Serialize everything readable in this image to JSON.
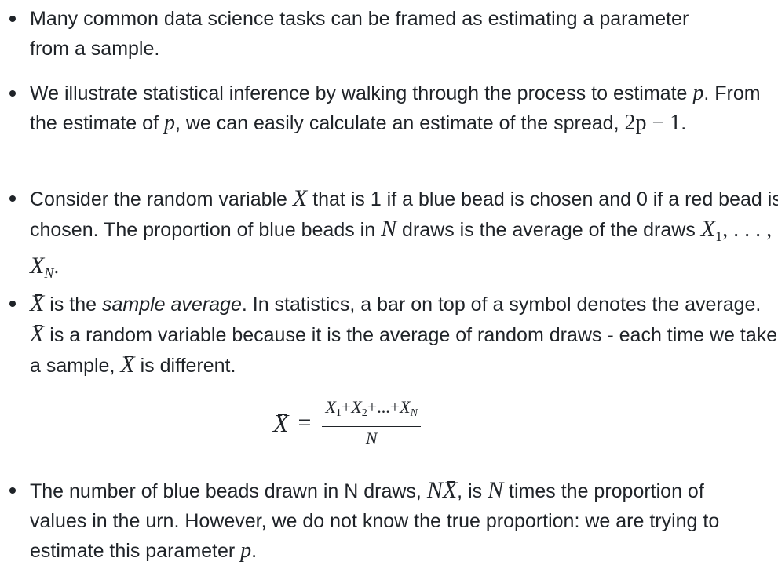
{
  "bullets": [
    {
      "t": "Many common data science tasks can be framed as estimating a parameter from a sample."
    },
    {
      "t1": "We illustrate statistical inference by walking through the process to estimate ",
      "p": "p",
      "t2": ". From the estimate of ",
      "t3": ", we can easily calculate an estimate of the spread, ",
      "spread": "2p − 1",
      "t4": "."
    },
    {
      "t1": "Consider the random variable ",
      "X": "X",
      "t2": " that is 1 if a blue bead is chosen and 0 if a red bead is chosen. The proportion of blue beads in ",
      "N": "N",
      "t3": " draws is the average of the draws ",
      "x1": "X",
      "x1sub": "1",
      "dots": ", . . . , ",
      "xn": "X",
      "xnsub": "N",
      "t4": "."
    },
    {
      "t1": " is the ",
      "em": "sample average",
      "t2": ". In statistics, a bar on top of a symbol denotes the average. ",
      "t3": " is a random variable because it is the average of random draws - each time we take a sample, ",
      "t4": " is different."
    },
    {
      "t1": "The number of blue beads drawn in N draws, ",
      "nx": "NX",
      "t2": ", is ",
      "t3": " times the proportion of values in the urn. However, we do not know the true proportion: we are trying to estimate this parameter ",
      "t4": "."
    }
  ],
  "formula": {
    "lhs": "X",
    "eq": "=",
    "num": {
      "a": "X",
      "as": "1",
      "plus1": "+",
      "b": "X",
      "bs": "2",
      "plus2": "+...+",
      "c": "X",
      "cs": "N"
    },
    "den": "N"
  }
}
